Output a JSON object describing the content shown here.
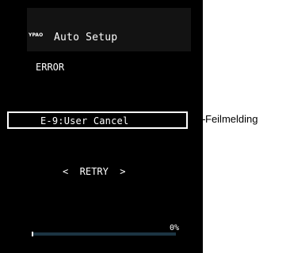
{
  "screen": {
    "brand": "YPAO",
    "title": "Auto Setup",
    "status": "ERROR",
    "error_message": "E-9:User Cancel",
    "retry_label": "<  RETRY  >",
    "progress_value": 0,
    "progress_label": "0%"
  },
  "annotation": {
    "label": "Feilmelding"
  },
  "colors": {
    "screen_background": "#000000",
    "header_band": "#131313",
    "text": "#ffffff",
    "progress_track": "#1c3442",
    "page_background": "#ffffff"
  }
}
